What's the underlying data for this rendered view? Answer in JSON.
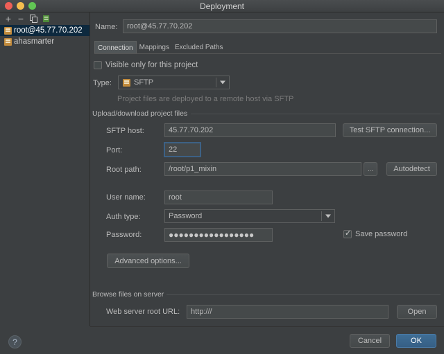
{
  "window": {
    "title": "Deployment"
  },
  "left_toolbar": {
    "icons": [
      "add-icon",
      "remove-icon",
      "copy-icon",
      "default-server-icon"
    ],
    "add_glyph": "+",
    "remove_glyph": "−"
  },
  "servers": [
    {
      "label": "root@45.77.70.202",
      "selected": true
    },
    {
      "label": "ahasmarter",
      "selected": false
    }
  ],
  "name": {
    "label": "Name:",
    "value": "root@45.77.70.202"
  },
  "tabs": [
    {
      "label": "Connection",
      "active": true
    },
    {
      "label": "Mappings",
      "active": false
    },
    {
      "label": "Excluded Paths",
      "active": false
    }
  ],
  "visible_only": {
    "label": "Visible only for this project",
    "checked": false
  },
  "type": {
    "label": "Type:",
    "value": "SFTP",
    "hint": "Project files are deployed to a remote host via SFTP"
  },
  "upload_section": {
    "title": "Upload/download project files"
  },
  "sftp_host": {
    "label": "SFTP host:",
    "value": "45.77.70.202",
    "test_button": "Test SFTP connection..."
  },
  "port": {
    "label": "Port:",
    "value": "22"
  },
  "root_path": {
    "label": "Root path:",
    "value": "/root/p1_mixin",
    "browse_button": "...",
    "autodetect_button": "Autodetect"
  },
  "user_name": {
    "label": "User name:",
    "value": "root"
  },
  "auth_type": {
    "label": "Auth type:",
    "value": "Password"
  },
  "password": {
    "label": "Password:",
    "value": "●●●●●●●●●●●●●●●●●"
  },
  "save_password": {
    "label": "Save password",
    "checked": true
  },
  "advanced_button": "Advanced options...",
  "browse_section": {
    "title": "Browse files on server"
  },
  "web_server": {
    "label": "Web server root URL:",
    "value": "http:///",
    "open_button": "Open"
  },
  "footer": {
    "cancel": "Cancel",
    "ok": "OK",
    "help_glyph": "?"
  },
  "colors": {
    "accent": "#365f85",
    "selection": "#0d293e",
    "background": "#3c3f41"
  }
}
